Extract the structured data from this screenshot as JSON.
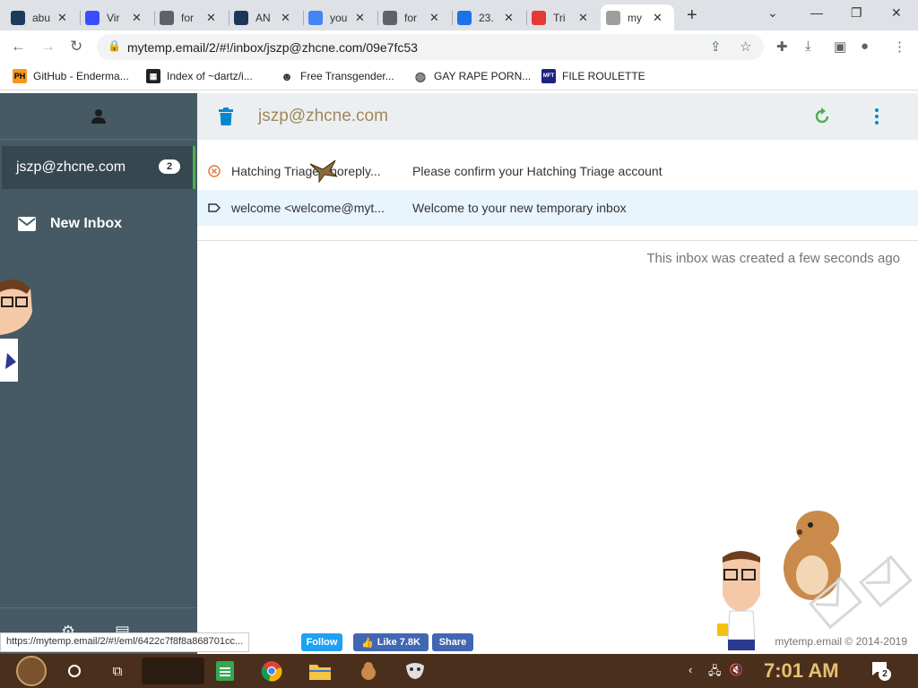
{
  "browser": {
    "tabs": [
      {
        "label": "abu",
        "icon": "a-logo-icon",
        "color": "#1b3a5c"
      },
      {
        "label": "Vir",
        "icon": "sigma-icon",
        "color": "#394eff"
      },
      {
        "label": "for",
        "icon": "globe-icon",
        "color": "#5f6368"
      },
      {
        "label": "AN",
        "icon": "any-run-icon",
        "color": "#1d3557"
      },
      {
        "label": "you",
        "icon": "google-icon",
        "color": "#4285f4"
      },
      {
        "label": "for",
        "icon": "globe-icon",
        "color": "#5f6368"
      },
      {
        "label": "23.",
        "icon": "pin-icon",
        "color": "#1a73e8"
      },
      {
        "label": "Tri",
        "icon": "triage-icon",
        "color": "#e53935"
      },
      {
        "label": "my",
        "icon": "at-icon",
        "color": "#9e9e9e"
      }
    ],
    "close_glyph": "✕",
    "new_tab_glyph": "+",
    "url": "mytemp.email/2/#!/inbox/jszp@zhcne.com/09e7fc53",
    "bookmarks": [
      {
        "label": "GitHub - Enderma...",
        "icon": "ph-icon",
        "icon_text": "PH"
      },
      {
        "label": "Index of ~dartz/i...",
        "icon": "image-icon",
        "icon_text": ""
      },
      {
        "label": "Free Transgender...",
        "icon": "mask-icon",
        "icon_text": ""
      },
      {
        "label": "GAY RAPE PORN...",
        "icon": "globe-icon",
        "icon_text": ""
      },
      {
        "label": "FILE ROULETTE",
        "icon": "mft-icon",
        "icon_text": "MFT"
      }
    ],
    "status_url": "https://mytemp.email/2/#!/eml/6422c7f8f8a868701cc..."
  },
  "sidebar": {
    "inbox": {
      "label": "jszp@zhcne.com",
      "count": "2"
    },
    "new_inbox_label": "New Inbox"
  },
  "main": {
    "header_email": "jszp@zhcne.com",
    "messages": [
      {
        "from": "Hatching Triage <noreply...",
        "subject": "Please confirm your Hatching Triage account",
        "status": "unread"
      },
      {
        "from": "welcome <welcome@myt...",
        "subject": "Welcome to your new temporary inbox",
        "status": "read"
      }
    ],
    "created_text": "This inbox was created a few seconds ago"
  },
  "footer": {
    "follow_label": "Follow",
    "like_label": "Like 7.8K",
    "share_label": "Share",
    "copyright": "mytemp.email © 2014-2019"
  },
  "taskbar": {
    "clock": "7:01 AM",
    "notification_count": "2"
  },
  "colors": {
    "sidebar_bg": "#455a64",
    "accent_green": "#4caf50",
    "trash_blue": "#0288d1",
    "facebook_blue": "#4267b2"
  }
}
